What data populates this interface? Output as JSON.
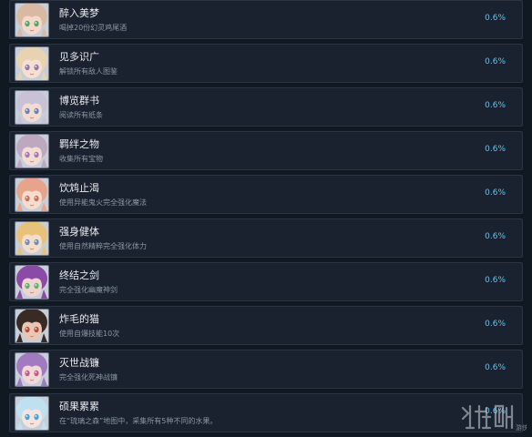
{
  "achievements": [
    {
      "title": "醉入美梦",
      "desc": "喝掉20份幻灵鸡尾酒",
      "percent": "0.6%",
      "icon": "girl-green-eyes-avatar-icon",
      "hair": "#d9b9a2",
      "skin": "#f4d8c9",
      "eye": "#5aa06a"
    },
    {
      "title": "见多识广",
      "desc": "解锁所有敌人图鉴",
      "percent": "0.6%",
      "icon": "girl-blonde-avatar-icon",
      "hair": "#e7d3b1",
      "skin": "#f6dfd1",
      "eye": "#8c7aa8"
    },
    {
      "title": "博览群书",
      "desc": "阅读所有纸条",
      "percent": "0.6%",
      "icon": "girl-silver-bow-avatar-icon",
      "hair": "#c9c1d6",
      "skin": "#f2dcd2",
      "eye": "#6d7fb0"
    },
    {
      "title": "羁绊之物",
      "desc": "收集所有宝物",
      "percent": "0.6%",
      "icon": "girl-lilac-avatar-icon",
      "hair": "#bda8c0",
      "skin": "#f3ddd3",
      "eye": "#a37ab5"
    },
    {
      "title": "饮鸩止渴",
      "desc": "使用异能鬼火完全强化魔法",
      "percent": "0.6%",
      "icon": "girl-pink-hair-avatar-icon",
      "hair": "#e6a58a",
      "skin": "#f6dccd",
      "eye": "#c86f5a"
    },
    {
      "title": "强身健体",
      "desc": "使用自然精粹完全强化体力",
      "percent": "0.6%",
      "icon": "girl-golden-hair-avatar-icon",
      "hair": "#e8c27a",
      "skin": "#f6ddc9",
      "eye": "#6a8fb8"
    },
    {
      "title": "终结之剑",
      "desc": "完全强化幽魔神剑",
      "percent": "0.6%",
      "icon": "girl-purple-hair-avatar-icon",
      "hair": "#8a4aa6",
      "skin": "#f0d4d2",
      "eye": "#5fb06f"
    },
    {
      "title": "炸毛的猫",
      "desc": "使用自爆技能10次",
      "percent": "0.6%",
      "icon": "girl-dark-hair-avatar-icon",
      "hair": "#3a2a25",
      "skin": "#e9c7b4",
      "eye": "#b0503a"
    },
    {
      "title": "灭世战镰",
      "desc": "完全强化死神战镰",
      "percent": "0.6%",
      "icon": "girl-violet-hair-avatar-icon",
      "hair": "#a27ac0",
      "skin": "#f1d8d8",
      "eye": "#c05a8a"
    },
    {
      "title": "硕果累累",
      "desc": "在“琉璃之森”地图中，采集所有5种不同的水果。",
      "percent": "0.6%",
      "icon": "girl-light-blue-hair-avatar-icon",
      "hair": "#bfe0ee",
      "skin": "#f4e4e0",
      "eye": "#4f9fd0"
    }
  ],
  "watermark": {
    "text": "游侠网",
    "icon": "site-logo-watermark-icon"
  },
  "colors": {
    "background": "#101822",
    "row": "#19222e",
    "percent": "#67c1f5"
  }
}
